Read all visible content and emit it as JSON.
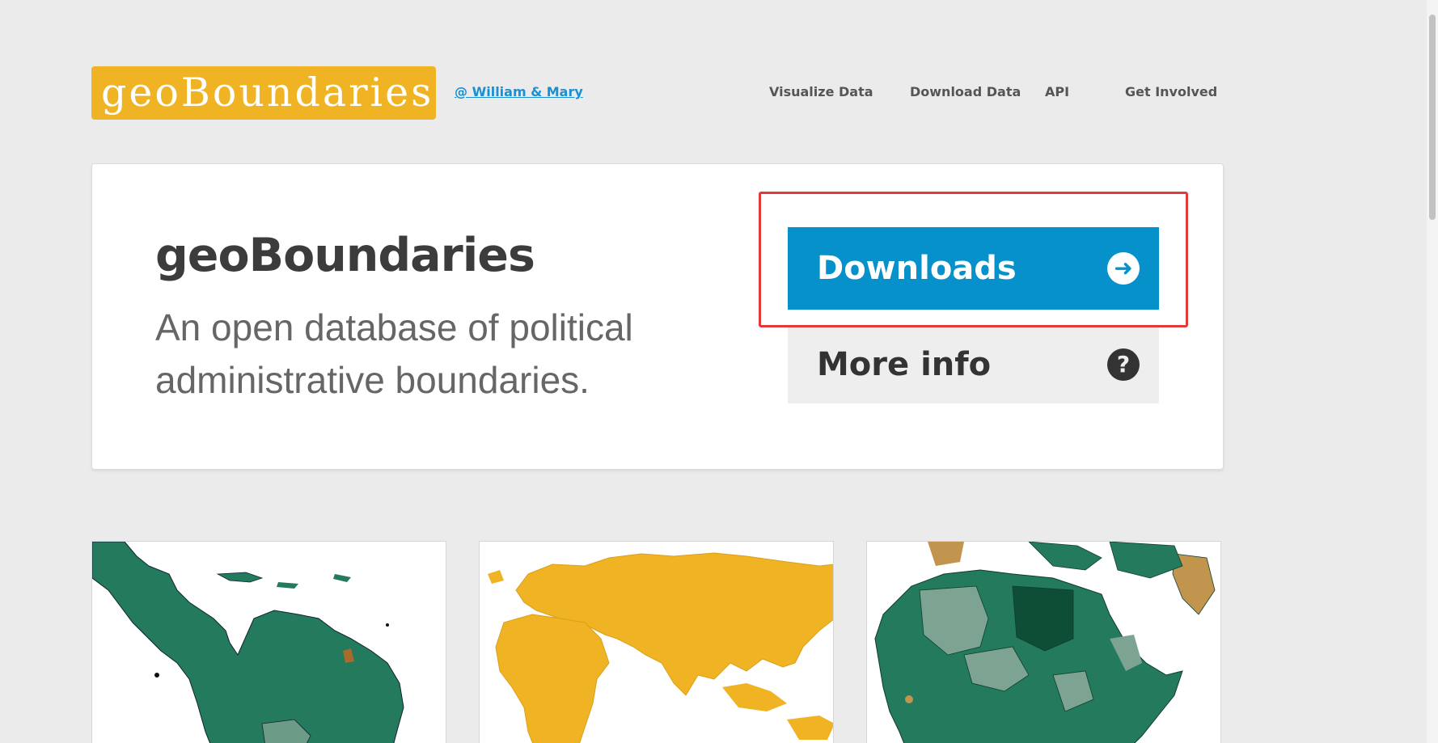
{
  "header": {
    "logo_text": "geoBoundaries",
    "affiliation_link": "@ William & Mary",
    "nav": [
      "Visualize Data",
      "Download Data",
      "API",
      "Get Involved"
    ]
  },
  "hero": {
    "title": "geoBoundaries",
    "subtitle": "An open database of political administrative boundaries.",
    "downloads_label": "Downloads",
    "more_info_label": "More info"
  },
  "colors": {
    "brand_yellow": "#f0b323",
    "download_blue": "#0691cb",
    "map_green": "#237a5c",
    "map_gold": "#f0b323",
    "highlight_red": "#e03a3a"
  },
  "icons": [
    "arrow-right-circle-icon",
    "question-circle-icon"
  ]
}
